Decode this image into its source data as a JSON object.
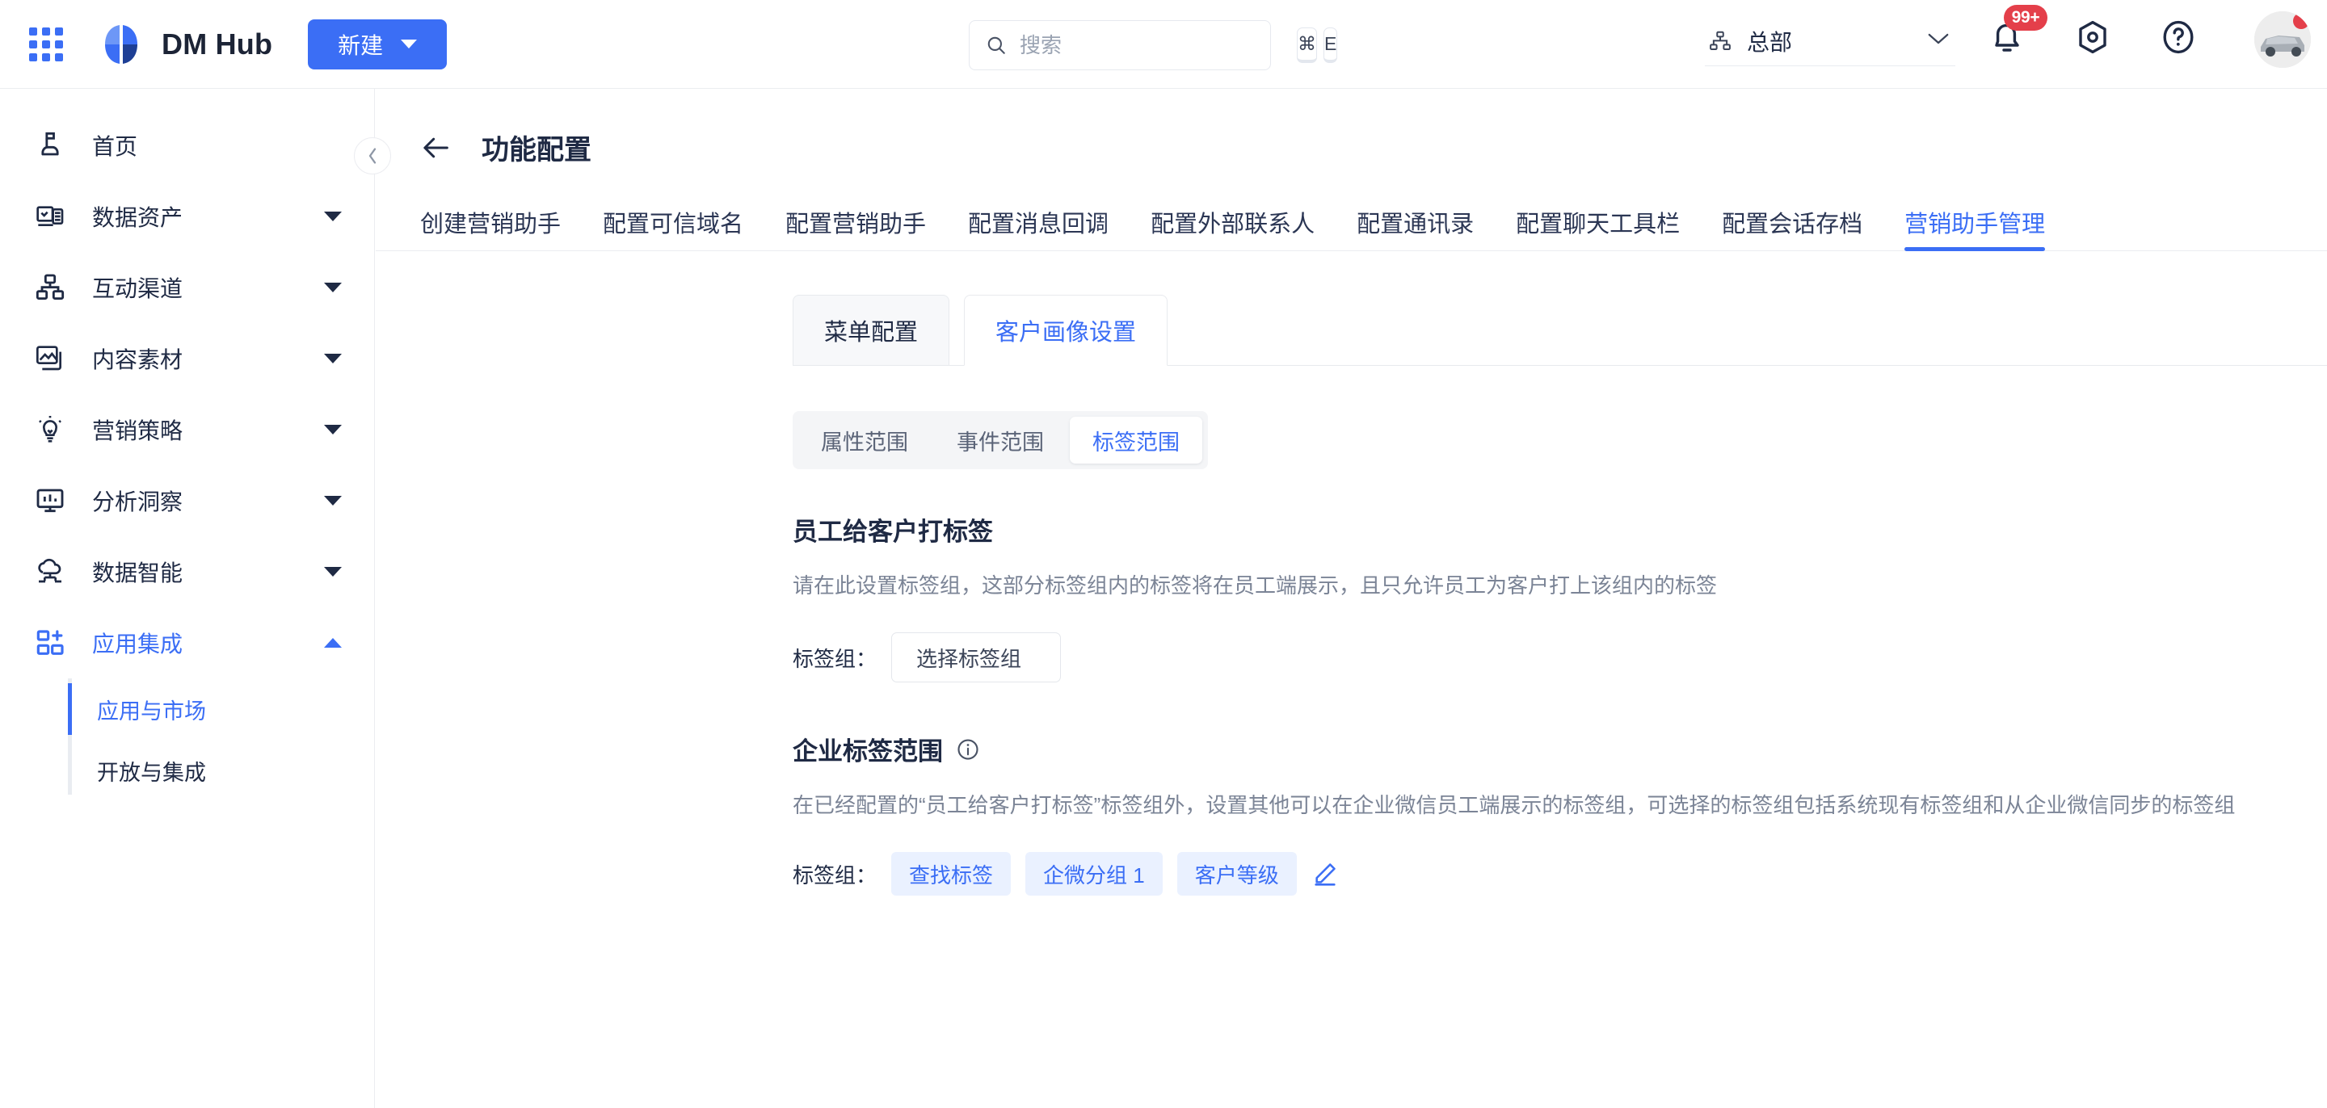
{
  "topbar": {
    "app_launcher_icon": "grid-apps-icon",
    "brand_name": "DM Hub",
    "new_button_label": "新建",
    "search": {
      "placeholder": "搜索",
      "value": "",
      "icon": "search-icon",
      "kbd_cmd": "⌘",
      "kbd_key": "E"
    },
    "org": {
      "label": "总部",
      "icon": "org-tree-icon"
    },
    "notification": {
      "icon": "bell-icon",
      "badge": "99+"
    },
    "settings_icon": "gear-hex-icon",
    "help_icon": "question-circle-icon",
    "avatar": {
      "icon": "user-avatar",
      "status_dot": true
    }
  },
  "sidebar": {
    "collapse_icon": "chevron-left-icon",
    "items": [
      {
        "label": "首页",
        "icon": "home-flag-icon",
        "expandable": false,
        "active": false
      },
      {
        "label": "数据资产",
        "icon": "data-assets-icon",
        "expandable": true,
        "expanded": false,
        "active": false
      },
      {
        "label": "互动渠道",
        "icon": "channels-icon",
        "expandable": true,
        "expanded": false,
        "active": false
      },
      {
        "label": "内容素材",
        "icon": "content-image-icon",
        "expandable": true,
        "expanded": false,
        "active": false
      },
      {
        "label": "营销策略",
        "icon": "bulb-icon",
        "expandable": true,
        "expanded": false,
        "active": false
      },
      {
        "label": "分析洞察",
        "icon": "analytics-monitor-icon",
        "expandable": true,
        "expanded": false,
        "active": false
      },
      {
        "label": "数据智能",
        "icon": "cloud-ai-icon",
        "expandable": true,
        "expanded": false,
        "active": false
      },
      {
        "label": "应用集成",
        "icon": "app-integration-icon",
        "expandable": true,
        "expanded": true,
        "active": true
      }
    ],
    "subitems": [
      {
        "label": "应用与市场",
        "active": true
      },
      {
        "label": "开放与集成",
        "active": false
      }
    ]
  },
  "page": {
    "back_icon": "arrow-left-icon",
    "title": "功能配置",
    "nav_tabs": [
      {
        "label": "创建营销助手",
        "active": false
      },
      {
        "label": "配置可信域名",
        "active": false
      },
      {
        "label": "配置营销助手",
        "active": false
      },
      {
        "label": "配置消息回调",
        "active": false
      },
      {
        "label": "配置外部联系人",
        "active": false
      },
      {
        "label": "配置通讯录",
        "active": false
      },
      {
        "label": "配置聊天工具栏",
        "active": false
      },
      {
        "label": "配置会话存档",
        "active": false
      },
      {
        "label": "营销助手管理",
        "active": true
      }
    ],
    "card_tabs": [
      {
        "label": "菜单配置",
        "active": false
      },
      {
        "label": "客户画像设置",
        "active": true
      }
    ],
    "segment_tabs": [
      {
        "label": "属性范围",
        "active": false
      },
      {
        "label": "事件范围",
        "active": false
      },
      {
        "label": "标签范围",
        "active": true
      }
    ],
    "sections": [
      {
        "title": "员工给客户打标签",
        "description": "请在此设置标签组，这部分标签组内的标签将在员工端展示，且只允许员工为客户打上该组内的标签",
        "field_label": "标签组：",
        "select_value": "选择标签组",
        "has_info": false
      },
      {
        "title": "企业标签范围",
        "description": "在已经配置的“员工给客户打标签”标签组外，设置其他可以在企业微信员工端展示的标签组，可选择的标签组包括系统现有标签组和从企业微信同步的标签组",
        "field_label": "标签组：",
        "chips": [
          "查找标签",
          "企微分组 1",
          "客户等级"
        ],
        "edit_icon": "pencil-edit-icon",
        "info_icon": "info-circle-icon",
        "has_info": true
      }
    ]
  },
  "colors": {
    "accent": "#3b6ef5",
    "text_primary": "#1f2a44",
    "text_muted": "#7b8496",
    "badge_red": "#e43f4a",
    "chip_bg": "#eaf1ff",
    "border": "#ebedf0"
  }
}
